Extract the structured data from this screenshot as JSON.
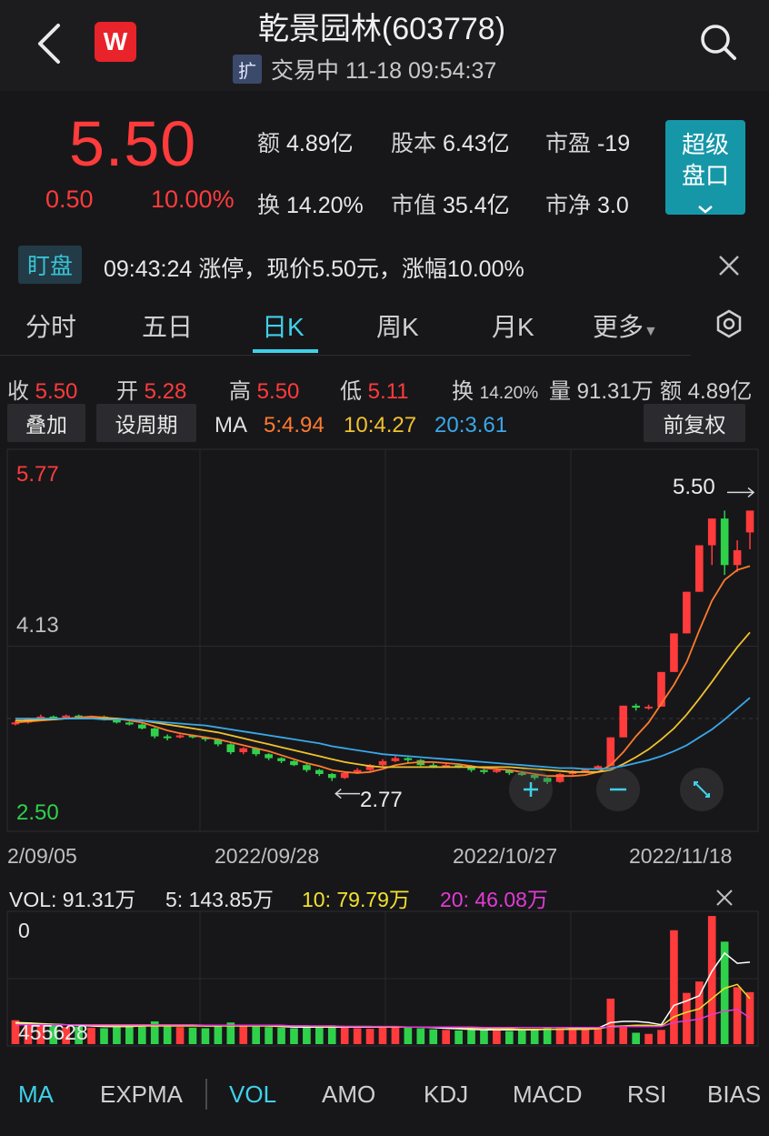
{
  "header": {
    "title": "乾景园林(603778)",
    "badge": "扩",
    "status": "交易中 11-18 09:54:37",
    "logo_letter": "W"
  },
  "quote": {
    "price": "5.50",
    "change": "0.50",
    "change_pct": "10.00%",
    "fields": [
      {
        "label": "额",
        "value": "4.89亿"
      },
      {
        "label": "股本",
        "value": "6.43亿"
      },
      {
        "label": "市盈",
        "value": "-19"
      },
      {
        "label": "换",
        "value": "14.20%"
      },
      {
        "label": "市值",
        "value": "35.4亿"
      },
      {
        "label": "市净",
        "value": "3.0"
      }
    ],
    "super_button": {
      "line1": "超级",
      "line2": "盘口"
    }
  },
  "alert": {
    "tag": "盯盘",
    "text": "09:43:24 涨停，现价5.50元，涨幅10.00%"
  },
  "tabs": [
    {
      "label": "分时"
    },
    {
      "label": "五日"
    },
    {
      "label": "日K"
    },
    {
      "label": "周K"
    },
    {
      "label": "月K"
    },
    {
      "label": "更多"
    }
  ],
  "ohlc": {
    "close_label": "收",
    "close": "5.50",
    "open_label": "开",
    "open": "5.28",
    "high_label": "高",
    "high": "5.50",
    "low_label": "低",
    "low": "5.11",
    "turnover_label": "换",
    "turnover": "14.20%",
    "volume_label": "量",
    "volume": "91.31万",
    "amount_label": "额",
    "amount": "4.89亿"
  },
  "toolbar": {
    "overlay": "叠加",
    "period": "设周期",
    "ma_label": "MA",
    "ma5": "5:4.94",
    "ma10": "10:4.27",
    "ma20": "20:3.61",
    "adjust": "前复权"
  },
  "chart": {
    "y_top": "5.77",
    "y_mid": "4.13",
    "y_bottom": "2.50",
    "high_marker": "5.50",
    "low_marker": "2.77",
    "dates": [
      "2/09/05",
      "2022/09/28",
      "2022/10/27",
      "2022/11/18"
    ]
  },
  "volume": {
    "vol": "VOL: 91.31万",
    "v5": "5: 143.85万",
    "v10": "10: 79.79万",
    "v20": "20: 46.08万",
    "y_top": "0",
    "y_mid": "455628"
  },
  "bottom_tabs": [
    {
      "label": "MA"
    },
    {
      "label": "EXPMA"
    },
    {
      "label": "VOL"
    },
    {
      "label": "AMO"
    },
    {
      "label": "KDJ"
    },
    {
      "label": "MACD"
    },
    {
      "label": "RSI"
    },
    {
      "label": "BIAS"
    }
  ],
  "colors": {
    "up": "#ff3b3b",
    "down": "#2fd14b",
    "accent": "#3fd0e8",
    "ma5": "#ff7a2e",
    "ma10": "#f2c12e",
    "ma20": "#3aa8e8",
    "vma20": "#e23bd6"
  },
  "chart_data": {
    "type": "candlestick",
    "title": "",
    "y_ticks": [
      5.77,
      4.13,
      2.5
    ],
    "ylim": [
      2.5,
      5.77
    ],
    "x_ticks": [
      "2/09/05",
      "2022/09/28",
      "2022/10/27",
      "2022/11/18"
    ],
    "candles": [
      [
        3.35,
        3.36,
        3.33,
        3.38
      ],
      [
        3.36,
        3.4,
        3.35,
        3.41
      ],
      [
        3.4,
        3.42,
        3.39,
        3.44
      ],
      [
        3.42,
        3.4,
        3.39,
        3.43
      ],
      [
        3.4,
        3.43,
        3.39,
        3.44
      ],
      [
        3.43,
        3.41,
        3.4,
        3.44
      ],
      [
        3.41,
        3.42,
        3.4,
        3.43
      ],
      [
        3.42,
        3.39,
        3.38,
        3.43
      ],
      [
        3.39,
        3.36,
        3.35,
        3.4
      ],
      [
        3.36,
        3.34,
        3.33,
        3.37
      ],
      [
        3.34,
        3.3,
        3.29,
        3.35
      ],
      [
        3.3,
        3.22,
        3.2,
        3.31
      ],
      [
        3.22,
        3.21,
        3.18,
        3.24
      ],
      [
        3.21,
        3.23,
        3.2,
        3.24
      ],
      [
        3.23,
        3.21,
        3.2,
        3.24
      ],
      [
        3.21,
        3.19,
        3.17,
        3.22
      ],
      [
        3.19,
        3.14,
        3.12,
        3.2
      ],
      [
        3.14,
        3.06,
        3.04,
        3.15
      ],
      [
        3.06,
        3.1,
        3.04,
        3.11
      ],
      [
        3.1,
        3.04,
        3.02,
        3.11
      ],
      [
        3.04,
        3.0,
        2.98,
        3.05
      ],
      [
        3.0,
        2.97,
        2.95,
        3.01
      ],
      [
        2.97,
        2.93,
        2.92,
        2.98
      ],
      [
        2.93,
        2.88,
        2.86,
        2.94
      ],
      [
        2.88,
        2.84,
        2.82,
        2.89
      ],
      [
        2.84,
        2.8,
        2.77,
        2.85
      ],
      [
        2.8,
        2.85,
        2.79,
        2.86
      ],
      [
        2.85,
        2.88,
        2.84,
        2.9
      ],
      [
        2.88,
        2.93,
        2.87,
        2.94
      ],
      [
        2.93,
        2.97,
        2.92,
        2.99
      ],
      [
        2.97,
        3.0,
        2.96,
        3.02
      ],
      [
        3.0,
        2.98,
        2.95,
        3.01
      ],
      [
        2.98,
        2.93,
        2.92,
        2.99
      ],
      [
        2.93,
        2.92,
        2.9,
        2.95
      ],
      [
        2.92,
        2.93,
        2.91,
        2.95
      ],
      [
        2.93,
        2.92,
        2.9,
        2.94
      ],
      [
        2.92,
        2.88,
        2.86,
        2.93
      ],
      [
        2.88,
        2.86,
        2.84,
        2.89
      ],
      [
        2.86,
        2.88,
        2.85,
        2.9
      ],
      [
        2.88,
        2.85,
        2.83,
        2.89
      ],
      [
        2.85,
        2.83,
        2.82,
        2.87
      ],
      [
        2.83,
        2.8,
        2.78,
        2.84
      ],
      [
        2.8,
        2.76,
        2.74,
        2.81
      ],
      [
        2.76,
        2.84,
        2.75,
        2.85
      ],
      [
        2.84,
        2.87,
        2.83,
        2.88
      ],
      [
        2.87,
        2.89,
        2.86,
        2.9
      ],
      [
        2.89,
        2.92,
        2.88,
        2.93
      ],
      [
        2.92,
        3.21,
        2.92,
        3.21
      ],
      [
        3.21,
        3.53,
        3.21,
        3.53
      ],
      [
        3.53,
        3.51,
        3.48,
        3.55
      ],
      [
        3.51,
        3.52,
        3.49,
        3.54
      ],
      [
        3.52,
        3.87,
        3.52,
        3.87
      ],
      [
        3.87,
        4.26,
        3.87,
        4.26
      ],
      [
        4.26,
        4.68,
        4.26,
        4.68
      ],
      [
        4.68,
        5.15,
        4.68,
        5.15
      ],
      [
        5.15,
        5.42,
        4.95,
        5.42
      ],
      [
        5.42,
        4.95,
        4.85,
        5.5
      ],
      [
        4.95,
        5.1,
        4.88,
        5.2
      ],
      [
        5.28,
        5.5,
        5.11,
        5.5
      ]
    ],
    "series": [
      {
        "name": "5",
        "values": [
          3.36,
          3.37,
          3.38,
          3.39,
          3.4,
          3.41,
          3.42,
          3.41,
          3.4,
          3.38,
          3.36,
          3.32,
          3.28,
          3.25,
          3.23,
          3.21,
          3.19,
          3.16,
          3.13,
          3.1,
          3.07,
          3.03,
          2.99,
          2.95,
          2.92,
          2.88,
          2.86,
          2.85,
          2.86,
          2.89,
          2.93,
          2.95,
          2.96,
          2.96,
          2.95,
          2.94,
          2.92,
          2.9,
          2.89,
          2.88,
          2.86,
          2.84,
          2.82,
          2.82,
          2.82,
          2.83,
          2.86,
          2.93,
          3.06,
          3.22,
          3.36,
          3.55,
          3.74,
          3.97,
          4.29,
          4.59,
          4.8,
          4.9,
          4.94
        ]
      },
      {
        "name": "10",
        "values": [
          3.38,
          3.38,
          3.39,
          3.39,
          3.4,
          3.4,
          3.4,
          3.4,
          3.4,
          3.39,
          3.38,
          3.36,
          3.34,
          3.32,
          3.3,
          3.28,
          3.26,
          3.23,
          3.2,
          3.17,
          3.14,
          3.11,
          3.08,
          3.05,
          3.02,
          2.99,
          2.96,
          2.94,
          2.92,
          2.91,
          2.91,
          2.91,
          2.91,
          2.91,
          2.91,
          2.91,
          2.91,
          2.91,
          2.91,
          2.91,
          2.9,
          2.89,
          2.88,
          2.87,
          2.86,
          2.86,
          2.86,
          2.88,
          2.94,
          3.01,
          3.09,
          3.19,
          3.3,
          3.44,
          3.6,
          3.77,
          3.95,
          4.12,
          4.27
        ]
      },
      {
        "name": "20",
        "values": [
          3.4,
          3.4,
          3.4,
          3.4,
          3.4,
          3.4,
          3.4,
          3.39,
          3.39,
          3.39,
          3.38,
          3.37,
          3.36,
          3.35,
          3.34,
          3.33,
          3.31,
          3.29,
          3.27,
          3.25,
          3.23,
          3.21,
          3.19,
          3.17,
          3.15,
          3.12,
          3.1,
          3.08,
          3.06,
          3.04,
          3.03,
          3.02,
          3.01,
          3.0,
          2.99,
          2.98,
          2.97,
          2.96,
          2.95,
          2.94,
          2.93,
          2.92,
          2.91,
          2.9,
          2.9,
          2.89,
          2.89,
          2.9,
          2.92,
          2.95,
          2.98,
          3.02,
          3.07,
          3.13,
          3.21,
          3.29,
          3.39,
          3.5,
          3.61
        ]
      }
    ],
    "volume_data": {
      "ylim": [
        0,
        2300000
      ],
      "y_ticks": [
        455628
      ],
      "values": [
        420000,
        380000,
        350000,
        330000,
        300000,
        310000,
        290000,
        280000,
        300000,
        320000,
        350000,
        400000,
        340000,
        300000,
        290000,
        280000,
        320000,
        380000,
        330000,
        310000,
        300000,
        290000,
        280000,
        300000,
        310000,
        330000,
        300000,
        280000,
        270000,
        300000,
        320000,
        310000,
        280000,
        260000,
        250000,
        240000,
        250000,
        260000,
        240000,
        230000,
        250000,
        260000,
        300000,
        280000,
        260000,
        270000,
        290000,
        800000,
        300000,
        200000,
        180000,
        250000,
        2000000,
        900000,
        1100000,
        2250000,
        1800000,
        1000000,
        913100
      ],
      "ma": [
        {
          "name": "5",
          "values": [
            380000,
            370000,
            360000,
            350000,
            340000,
            330000,
            320000,
            310000,
            310000,
            310000,
            320000,
            330000,
            340000,
            340000,
            330000,
            320000,
            320000,
            330000,
            330000,
            330000,
            320000,
            310000,
            300000,
            300000,
            300000,
            300000,
            300000,
            300000,
            300000,
            300000,
            300000,
            300000,
            300000,
            290000,
            280000,
            270000,
            260000,
            250000,
            250000,
            250000,
            250000,
            250000,
            260000,
            260000,
            270000,
            270000,
            280000,
            380000,
            400000,
            400000,
            380000,
            340000,
            680000,
            760000,
            850000,
            1280000,
            1600000,
            1420000,
            1438500
          ]
        },
        {
          "name": "10",
          "values": [
            360000,
            355000,
            350000,
            345000,
            340000,
            335000,
            330000,
            325000,
            320000,
            320000,
            320000,
            320000,
            320000,
            320000,
            320000,
            320000,
            320000,
            320000,
            320000,
            320000,
            320000,
            320000,
            320000,
            320000,
            310000,
            310000,
            310000,
            310000,
            310000,
            300000,
            300000,
            300000,
            300000,
            300000,
            300000,
            290000,
            280000,
            280000,
            270000,
            270000,
            260000,
            260000,
            260000,
            260000,
            260000,
            260000,
            270000,
            310000,
            320000,
            330000,
            330000,
            320000,
            480000,
            560000,
            620000,
            800000,
            980000,
            1050000,
            797900
          ]
        },
        {
          "name": "20",
          "values": [
            340000,
            340000,
            340000,
            340000,
            340000,
            340000,
            340000,
            340000,
            340000,
            340000,
            340000,
            340000,
            340000,
            340000,
            340000,
            330000,
            330000,
            330000,
            330000,
            330000,
            330000,
            330000,
            320000,
            320000,
            320000,
            320000,
            310000,
            310000,
            310000,
            310000,
            310000,
            300000,
            300000,
            300000,
            300000,
            300000,
            300000,
            290000,
            290000,
            290000,
            290000,
            290000,
            290000,
            290000,
            290000,
            290000,
            290000,
            300000,
            310000,
            310000,
            310000,
            310000,
            380000,
            410000,
            440000,
            520000,
            580000,
            610000,
            460800
          ]
        }
      ]
    }
  }
}
